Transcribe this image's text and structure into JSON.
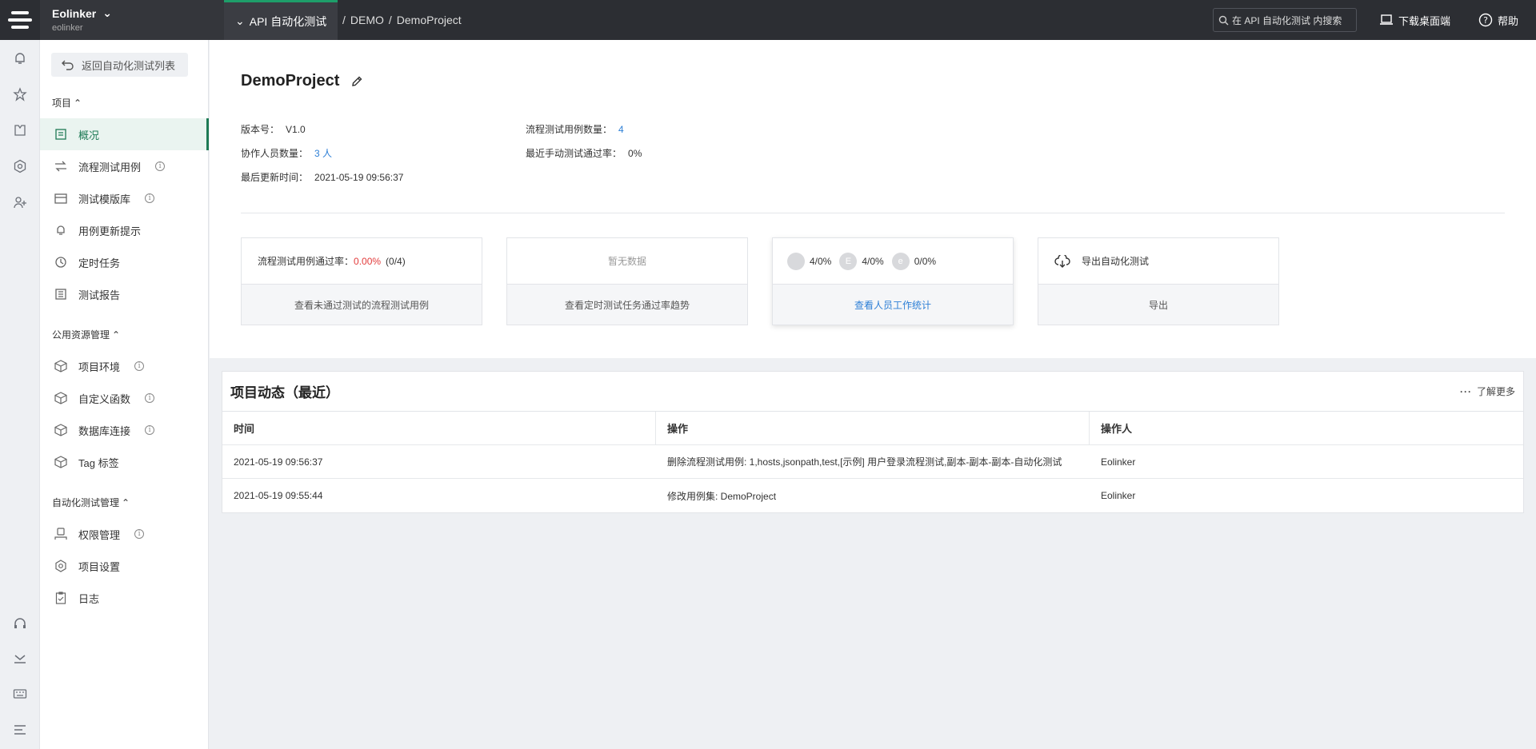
{
  "workspace": {
    "name": "Eolinker",
    "sub": "eolinker"
  },
  "topbar": {
    "module": "API 自动化测试",
    "breadcrumb": [
      "DEMO",
      "DemoProject"
    ],
    "search_placeholder": "在 API 自动化测试 内搜索",
    "download": "下载桌面端",
    "help": "帮助"
  },
  "rail_icons": [
    "bell-icon",
    "star-icon",
    "shirt-icon",
    "gear-icon",
    "add-user-icon",
    "headset-icon",
    "collapse-icon",
    "keyboard-icon",
    "menu-icon"
  ],
  "sidenav": {
    "back": "返回自动化测试列表",
    "group_project": "项目",
    "items_project": [
      {
        "label": "概况",
        "icon": "overview-icon",
        "info": false,
        "active": true
      },
      {
        "label": "流程测试用例",
        "icon": "flow-icon",
        "info": true
      },
      {
        "label": "测试模版库",
        "icon": "template-icon",
        "info": true
      },
      {
        "label": "用例更新提示",
        "icon": "bell-icon",
        "info": false
      },
      {
        "label": "定时任务",
        "icon": "clock-icon",
        "info": false
      },
      {
        "label": "测试报告",
        "icon": "report-icon",
        "info": false
      }
    ],
    "group_public": "公用资源管理",
    "items_public": [
      {
        "label": "项目环境",
        "icon": "cube-icon",
        "info": true
      },
      {
        "label": "自定义函数",
        "icon": "cube-icon",
        "info": true
      },
      {
        "label": "数据库连接",
        "icon": "cube-icon",
        "info": true
      },
      {
        "label": "Tag 标签",
        "icon": "cube-icon",
        "info": false
      }
    ],
    "group_auto": "自动化测试管理",
    "items_auto": [
      {
        "label": "权限管理",
        "icon": "user-perm-icon",
        "info": true
      },
      {
        "label": "项目设置",
        "icon": "gear-icon",
        "info": false
      },
      {
        "label": "日志",
        "icon": "log-icon",
        "info": false
      }
    ]
  },
  "project": {
    "title": "DemoProject",
    "version_label": "版本号：",
    "version": "V1.0",
    "members_label": "协作人员数量：",
    "members": "3 人",
    "updated_label": "最后更新时间：",
    "updated": "2021-05-19 09:56:37",
    "flow_count_label": "流程测试用例数量：",
    "flow_count": "4",
    "manual_rate_label": "最近手动测试通过率：",
    "manual_rate": "0%"
  },
  "cards": {
    "pass_rate_label": "流程测试用例通过率：",
    "pass_rate": "0.00%",
    "pass_rate_detail": "(0/4)",
    "pass_action": "查看未通过测试的流程测试用例",
    "no_data": "暂无数据",
    "trend_action": "查看定时测试任务通过率趋势",
    "stats": [
      {
        "avatar": "",
        "value": "4/0%"
      },
      {
        "avatar": "E",
        "value": "4/0%"
      },
      {
        "avatar": "e",
        "value": "0/0%"
      }
    ],
    "stats_action": "查看人员工作统计",
    "export_label": "导出自动化测试",
    "export_action": "导出"
  },
  "activity": {
    "title": "项目动态（最近）",
    "more": "了解更多",
    "columns": [
      "时间",
      "操作",
      "操作人"
    ],
    "rows": [
      {
        "time": "2021-05-19 09:56:37",
        "op": "删除流程测试用例: 1,hosts,jsonpath,test,[示例] 用户登录流程测试,副本-副本-副本-自动化测试",
        "user": "Eolinker"
      },
      {
        "time": "2021-05-19 09:55:44",
        "op": "修改用例集: DemoProject",
        "user": "Eolinker"
      }
    ]
  },
  "colors": {
    "accent": "#1e7a55",
    "link": "#2d7fd6",
    "danger": "#e23b3b",
    "topbar": "#2c2e33"
  }
}
